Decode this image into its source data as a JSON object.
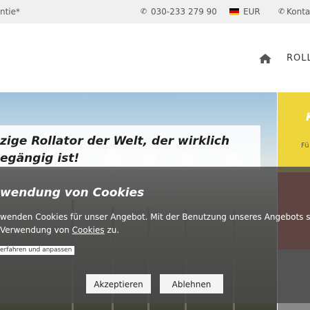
{
  "topbar": {
    "guarantee_text": "ntie*",
    "phone_number": "030-233 279 90",
    "currency": "EUR",
    "contact_label": "Konta",
    "phone_icon": "phone-icon",
    "flag_icon": "germany-flag-icon"
  },
  "nav": {
    "home_icon": "home-icon",
    "item_1": "ROLL"
  },
  "hero": {
    "title_line1": "zige Rollator der Welt, der wirklich",
    "title_line2": "egängig ist!"
  },
  "side_panels": {
    "yellow_bold": "K",
    "yellow_text": "Fü"
  },
  "cookie_banner": {
    "title": "wendung von Cookies",
    "text_line1": "wenden Cookies für unser Angebot. Mit der Benutzung unseres Angebots stim",
    "text_line2_prefix": "Verwendung von ",
    "text_line2_link": "Cookies",
    "text_line2_suffix": " zu.",
    "learn_more_label": "erfahren und anpassen",
    "accept_label": "Akzeptieren",
    "decline_label": "Ablehnen"
  },
  "colors": {
    "topbar_bg": "#f0f0f0",
    "accent_yellow": "#efd53c",
    "accent_red": "#c0392b",
    "overlay": "#484848"
  }
}
